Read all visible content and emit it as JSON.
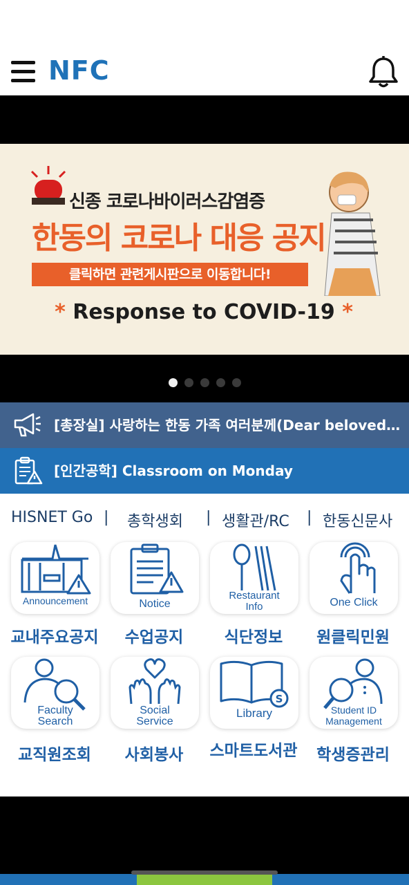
{
  "header": {
    "brand": "NFC",
    "menu_icon": "hamburger-icon",
    "bell_icon": "bell-icon"
  },
  "banner": {
    "line1": "신종 코로나바이러스감염증",
    "line2": "한동의 코로나 대응 공지",
    "line3": "클릭하면 관련게시판으로 이동합니다!",
    "line4": "Response to COVID-19",
    "star": "*",
    "page_count": 5,
    "active_page": 1
  },
  "notices": [
    {
      "icon": "megaphone-icon",
      "text": "[총장실] 사랑하는 한동 가족 여러분께(Dear beloved Handong family)"
    },
    {
      "icon": "clipboard-alert-icon",
      "text": "[인간공학] Classroom on Monday"
    }
  ],
  "quicklinks": [
    "HISNET Go",
    "총학생회",
    "생활관/RC",
    "한동신문사"
  ],
  "tiles": [
    {
      "label": "Announcement",
      "caption": "교내주요공지",
      "icon": "building-alert-icon"
    },
    {
      "label": "Notice",
      "caption": "수업공지",
      "icon": "document-alert-icon"
    },
    {
      "label": "Restaurant Info",
      "label_l1": "Restaurant",
      "label_l2": "Info",
      "caption": "식단정보",
      "icon": "utensils-icon"
    },
    {
      "label": "One Click",
      "caption": "원클릭민원",
      "icon": "tap-icon"
    },
    {
      "label": "Faculty Search",
      "label_l1": "Faculty",
      "label_l2": "Search",
      "caption": "교직원조회",
      "icon": "person-search-icon"
    },
    {
      "label": "Social Service",
      "label_l1": "Social",
      "label_l2": "Service",
      "caption": "사회봉사",
      "icon": "hands-heart-icon"
    },
    {
      "label": "Library",
      "caption": "스마트도서관",
      "icon": "book-icon"
    },
    {
      "label": "Student ID Management",
      "label_l1": "Student ID",
      "label_l2": "Management",
      "caption": "학생증관리",
      "icon": "id-search-icon"
    }
  ],
  "colors": {
    "brand": "#1f72b8",
    "notice1": "#41628d",
    "notice2": "#2171b6",
    "icon_blue": "#1f5fa5",
    "banner_orange": "#e8602a"
  }
}
